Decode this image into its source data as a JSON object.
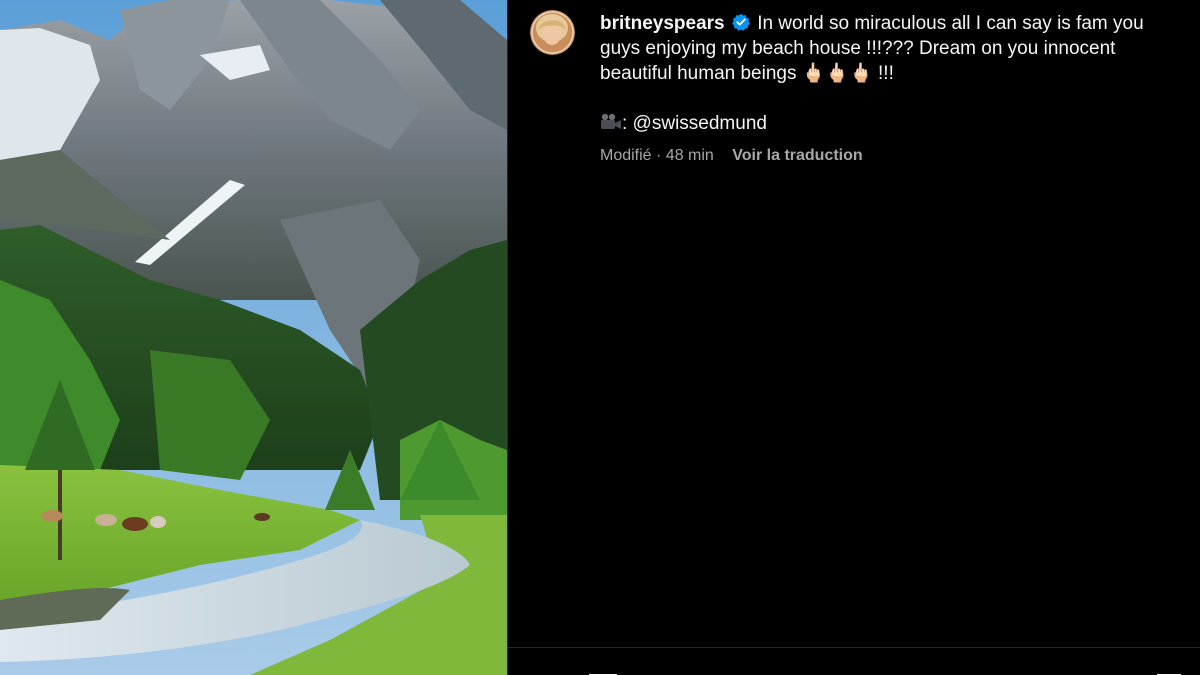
{
  "post": {
    "username": "britneyspears",
    "verified_icon": "verified-badge-icon",
    "caption": "In world so miraculous all I can say is fam you guys enjoying my beach house !!!??? Dream on you innocent beautiful human beings 🖕🏻🖕🏻🖕🏻 !!!",
    "credit_icon": "movie-camera-icon",
    "credit_text": ": @swissedmund",
    "modified_label": "Modifié · 48 min",
    "translate_label": "Voir la traduction"
  },
  "colors": {
    "background": "#000000",
    "text_primary": "#f5f5f5",
    "text_secondary": "#a8a8a8",
    "verified_blue": "#0095f6",
    "divider": "#262626"
  },
  "actions": {
    "icons": [
      "heart-icon",
      "comment-icon",
      "save-icon"
    ]
  }
}
